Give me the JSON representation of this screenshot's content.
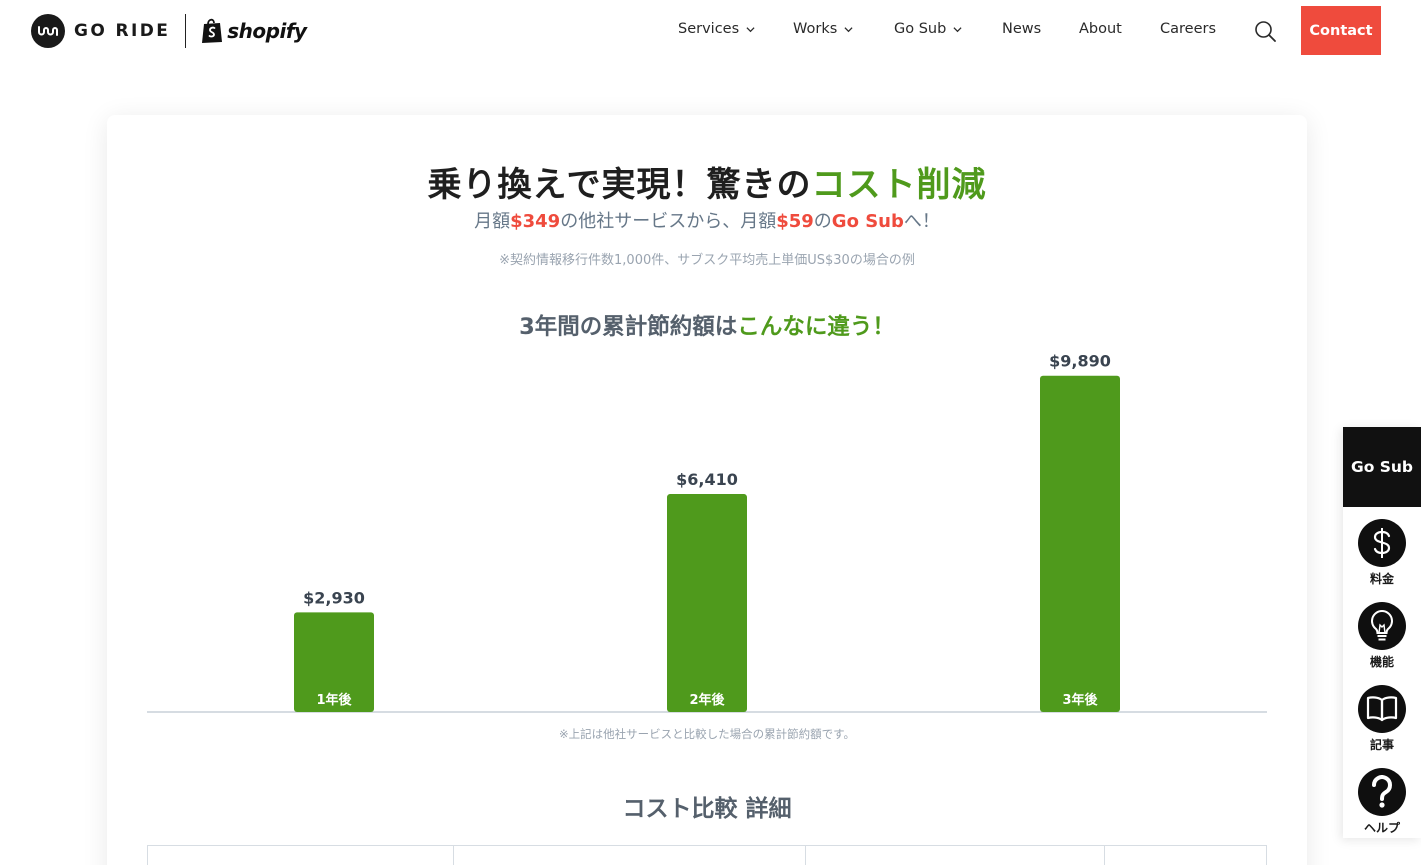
{
  "header": {
    "logo_goride": "GO RIDE",
    "logo_shopify": "shopify",
    "nav": [
      {
        "label": "Services",
        "dropdown": true
      },
      {
        "label": "Works",
        "dropdown": true
      },
      {
        "label": "Go Sub",
        "dropdown": true
      },
      {
        "label": "News",
        "dropdown": false
      },
      {
        "label": "About",
        "dropdown": false
      },
      {
        "label": "Careers",
        "dropdown": false
      }
    ],
    "search_icon": "search-icon",
    "contact_label": "Contact"
  },
  "hero": {
    "headline_main": "乗り換えで実現！驚きの",
    "headline_accent": "コスト削減",
    "sub_1": "月額",
    "sub_price_old": "$349",
    "sub_2": "の他社サービスから、月額",
    "sub_price_new": "$59",
    "sub_3": "の",
    "sub_product": "Go Sub",
    "sub_4": "へ！",
    "note": "※契約情報移行件数1,000件、サブスク平均売上単価US$30の場合の例"
  },
  "chart_section": {
    "title_main": "3年間の累計節約額は",
    "title_accent": "こんなに違う！",
    "caption": "※上記は他社サービスと比較した場合の累計節約額です。"
  },
  "chart_data": {
    "type": "bar",
    "categories": [
      "1年後",
      "2年後",
      "3年後"
    ],
    "values": [
      2930,
      6410,
      9890
    ],
    "value_labels": [
      "$2,930",
      "$6,410",
      "$9,890"
    ],
    "title": "3年間の累計節約額はこんなに違う！",
    "xlabel": "",
    "ylabel": "",
    "ylim": [
      0,
      10000
    ],
    "grid": false,
    "bar_color": "#4f9a1c"
  },
  "comparison": {
    "title": "コスト比較 詳細"
  },
  "side_tabs": {
    "top_label": "Go Sub",
    "items": [
      {
        "label": "料金",
        "icon": "dollar-icon"
      },
      {
        "label": "機能",
        "icon": "lightbulb-icon"
      },
      {
        "label": "記事",
        "icon": "book-icon"
      },
      {
        "label": "ヘルプ",
        "icon": "question-icon"
      }
    ]
  },
  "colors": {
    "accent_green": "#4f9a1c",
    "accent_red": "#ef4b3d",
    "dark": "#111111"
  }
}
